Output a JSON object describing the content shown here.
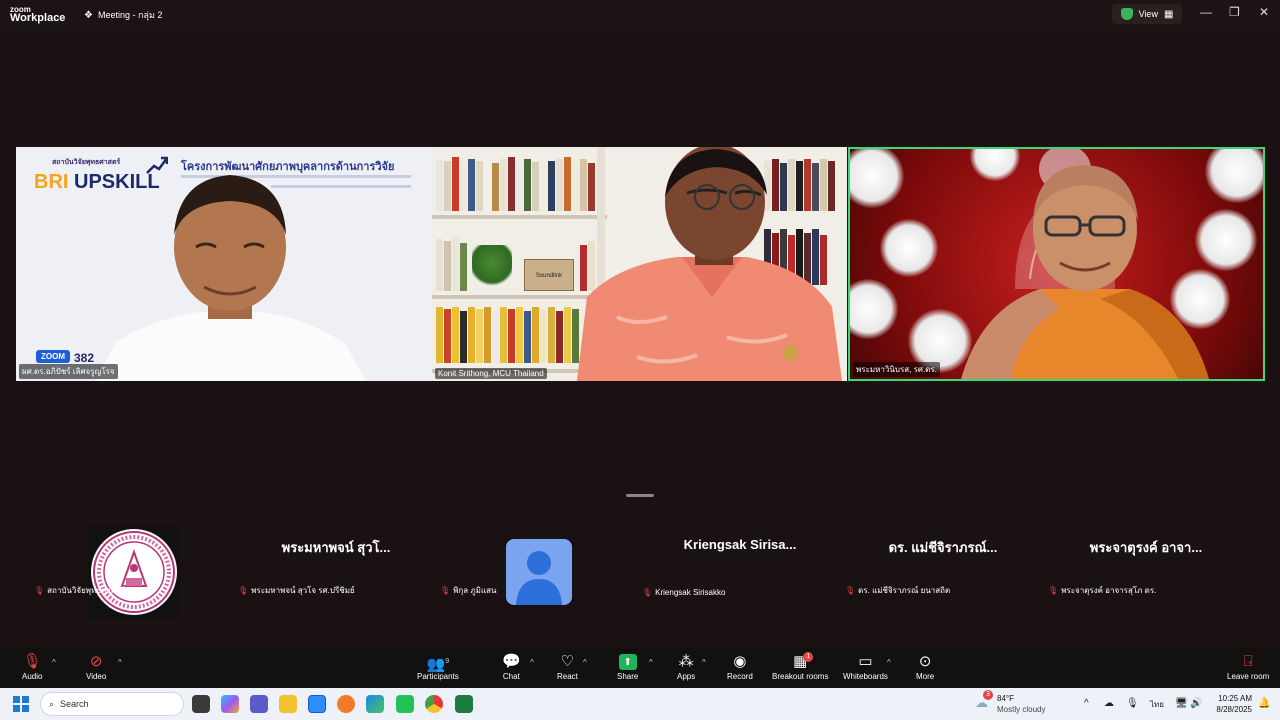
{
  "titlebar": {
    "logo_line1": "zoom",
    "logo_line2": "Workplace",
    "meeting_title": "Meeting - กลุ่ม 2",
    "view_label": "View"
  },
  "tiles": [
    {
      "name": "ผศ.ดร.อภิปัชร์ เลิศจรูญโรจ",
      "slide_small": "สถาบันวิจัยพุทธศาสตร์",
      "slide_brand_a": "BRI",
      "slide_brand_b": "UPSKILL",
      "slide_head": "โครงการพัฒนาศักยภาพบุคลากรด้านการวิจัย",
      "zoom_badge": "ZOOM",
      "zoom_num": "382"
    },
    {
      "name": "Konit Srithong, MCU Thailand",
      "book_label": "Soundlink"
    },
    {
      "name": "พระมหาวินิบรส, รศ.ดร."
    }
  ],
  "participants": [
    {
      "display": "",
      "label": "สถาบันวิจัยพุทธศาสตร์ มจร"
    },
    {
      "display": "พระมหาพจน์ สุวโ...",
      "label": "พระมหาพจน์ สุวโจ รศ.ปรีชิมย์"
    },
    {
      "display": "",
      "label": "พิกุล ภูมิแสน"
    },
    {
      "display": "Kriengsak Sirisa...",
      "label": "Kriengsak Sirisakko"
    },
    {
      "display": "ดร. แม่ชีจิราภรณ์...",
      "label": "ดร. แม่ชีจิราภรณ์ ยนาสถิต"
    },
    {
      "display": "พระจาตุรงค์ อาจา...",
      "label": "พระจาตุรงค์ อาจารสุโภ ดร."
    }
  ],
  "toolbar": {
    "audio": "Audio",
    "video": "Video",
    "participants": "Participants",
    "participants_count": "9",
    "chat": "Chat",
    "react": "React",
    "share": "Share",
    "apps": "Apps",
    "record": "Record",
    "breakout": "Breakout rooms",
    "breakout_badge": "1",
    "whiteboards": "Whiteboards",
    "more": "More",
    "leave": "Leave room"
  },
  "taskbar": {
    "search_placeholder": "Search",
    "temp": "84°F",
    "weather": "Mostly cloudy",
    "weather_badge": "3",
    "lang": "ไทย",
    "time": "10:25 AM",
    "date": "8/28/2025"
  },
  "colors": {
    "accent_green": "#3cd77a",
    "mute_red": "#e54545",
    "zoom_blue": "#1f5edb"
  }
}
